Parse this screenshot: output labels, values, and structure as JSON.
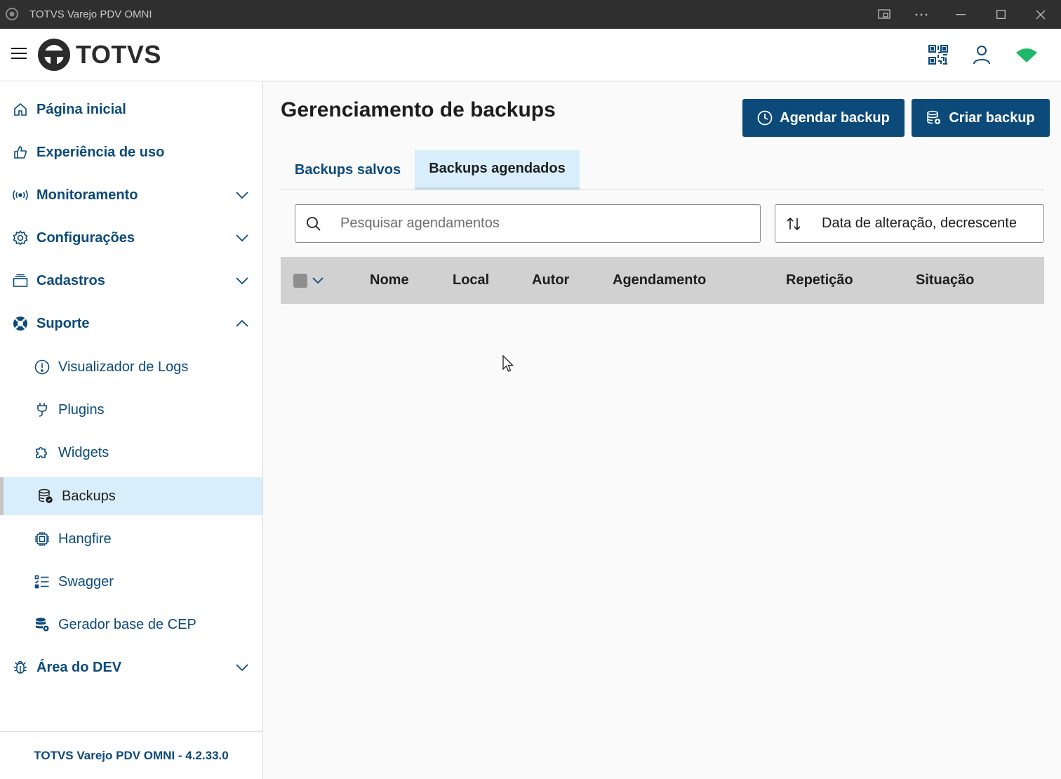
{
  "window": {
    "title": "TOTVS Varejo PDV OMNI"
  },
  "header": {
    "logo_text": "TOTVS"
  },
  "sidebar": {
    "items": [
      {
        "label": "Página inicial",
        "icon": "home-icon"
      },
      {
        "label": "Experiência de uso",
        "icon": "thumbs-up-icon"
      },
      {
        "label": "Monitoramento",
        "icon": "broadcast-icon",
        "expandable": true
      },
      {
        "label": "Configurações",
        "icon": "gear-icon",
        "expandable": true
      },
      {
        "label": "Cadastros",
        "icon": "stack-icon",
        "expandable": true
      },
      {
        "label": "Suporte",
        "icon": "lifebuoy-icon",
        "expanded": true
      },
      {
        "label": "Área do DEV",
        "icon": "bug-icon",
        "expandable": true
      }
    ],
    "support_items": [
      {
        "label": "Visualizador de Logs",
        "icon": "alert-circle-icon"
      },
      {
        "label": "Plugins",
        "icon": "plug-icon"
      },
      {
        "label": "Widgets",
        "icon": "puzzle-icon"
      },
      {
        "label": "Backups",
        "icon": "database-icon",
        "active": true
      },
      {
        "label": "Hangfire",
        "icon": "chip-icon"
      },
      {
        "label": "Swagger",
        "icon": "checklist-icon"
      },
      {
        "label": "Gerador base de CEP",
        "icon": "database-settings-icon"
      }
    ],
    "footer": "TOTVS Varejo PDV OMNI - 4.2.33.0"
  },
  "main": {
    "title": "Gerenciamento de backups",
    "schedule_button": "Agendar backup",
    "create_button": "Criar backup",
    "tabs": [
      {
        "label": "Backups salvos",
        "active": false
      },
      {
        "label": "Backups agendados",
        "active": true
      }
    ],
    "search_placeholder": "Pesquisar agendamentos",
    "sort_label": "Data de alteração, decrescente",
    "columns": [
      "Nome",
      "Local",
      "Autor",
      "Agendamento",
      "Repetição",
      "Situação"
    ]
  },
  "colors": {
    "primary": "#0c4a7a",
    "active_bg": "#d9eefb",
    "table_header_bg": "#d1d1d1",
    "status_wifi": "#1db86a"
  }
}
